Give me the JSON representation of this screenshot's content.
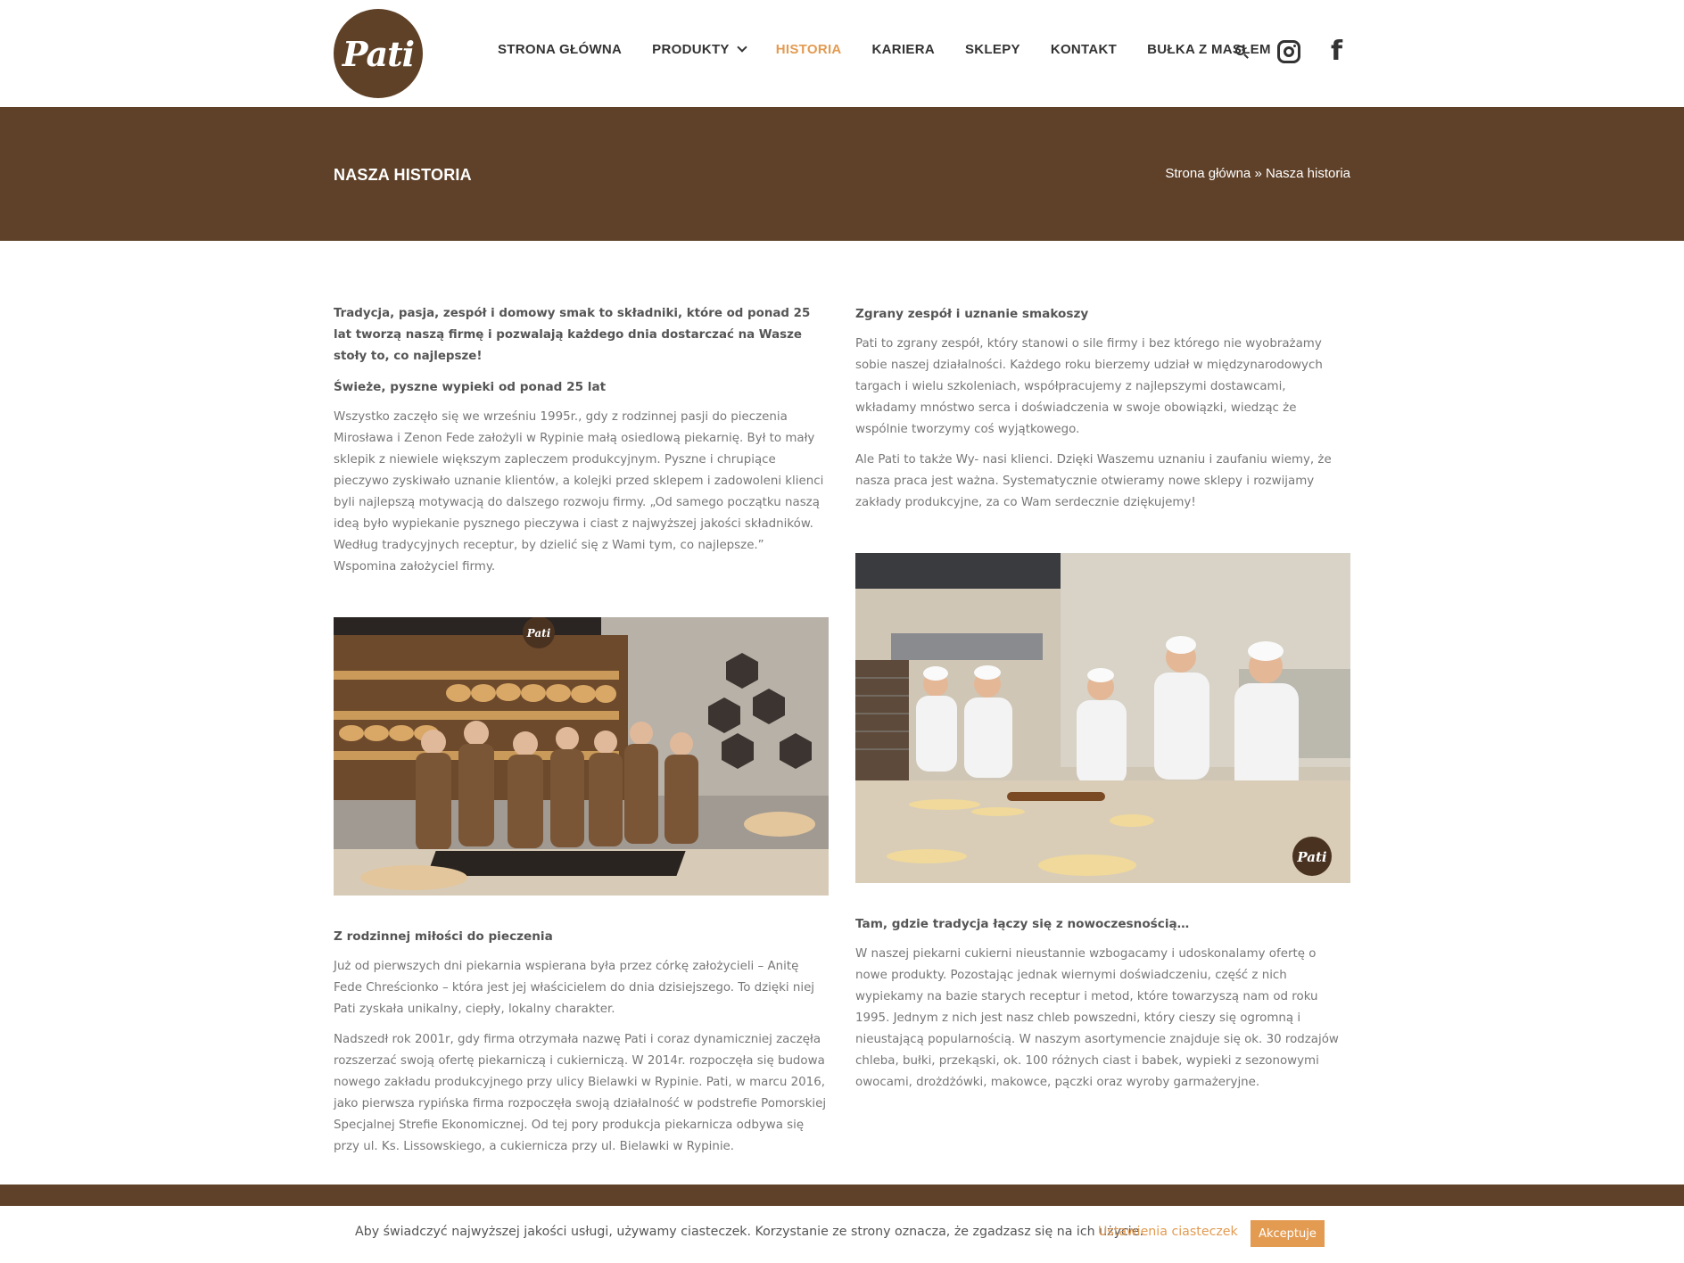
{
  "brand": {
    "logo_text": "Pati",
    "color": "#5f4127",
    "accent": "#e39b52"
  },
  "nav": {
    "items": [
      {
        "label": "STRONA GŁÓWNA"
      },
      {
        "label": "PRODUKTY"
      },
      {
        "label": "HISTORIA"
      },
      {
        "label": "KARIERA"
      },
      {
        "label": "SKLEPY"
      },
      {
        "label": "KONTAKT"
      },
      {
        "label": "BUŁKA Z MASŁEM"
      }
    ],
    "active": "HISTORIA",
    "icons": [
      "search-icon",
      "instagram-icon",
      "facebook-icon"
    ]
  },
  "header": {
    "title": "NASZA HISTORIA",
    "breadcrumb_home": "Strona główna",
    "breadcrumb_sep": "»",
    "breadcrumb_current": "Nasza historia"
  },
  "left": {
    "intro": "Tradycja, pasja, zespół i domowy smak to składniki, które od ponad 25 lat tworzą naszą firmę i pozwalają każdego dnia dostarczać na Wasze stoły to, co najlepsze!",
    "h1": "Świeże, pyszne wypieki od ponad 25 lat",
    "p1": "Wszystko zaczęło się we wrześniu 1995r., gdy z rodzinnej pasji do pieczenia Mirosława i Zenon Fede założyli w Rypinie małą osiedlową piekarnię. Był to mały sklepik z niewiele większym zapleczem produkcyjnym. Pyszne i chrupiące pieczywo zyskiwało uznanie klientów, a kolejki przed sklepem i zadowoleni klienci byli najlepszą motywacją do dalszego rozwoju firmy. „Od samego początku naszą ideą było wypiekanie pysznego pieczywa i ciast z najwyższej jakości składników. Według tradycyjnych receptur, by dzielić się z Wami tym, co najlepsze.” Wspomina założyciel firmy.",
    "h2": "Z rodzinnej miłości do pieczenia",
    "p2": "Już od pierwszych dni piekarnia wspierana była przez córkę założycieli – Anitę Fede Chreścionko – która jest jej właścicielem do dnia dzisiejszego. To dzięki niej Pati zyskała unikalny, ciepły, lokalny charakter.",
    "p3": "Nadszedł rok 2001r, gdy firma otrzymała nazwę Pati i coraz dynamiczniej zaczęła rozszerzać swoją ofertę piekarniczą i cukierniczą. W 2014r. rozpoczęła się budowa nowego zakładu produkcyjnego przy ulicy Bielawki w Rypinie. Pati, w marcu 2016, jako pierwsza rypińska firma rozpoczęła swoją działalność w podstrefie Pomorskiej Specjalnej Strefie Ekonomicznej. Od tej pory produkcja piekarnicza odbywa się przy ul. Ks. Lissowskiego, a cukiernicza przy ul. Bielawki w Rypinie."
  },
  "right": {
    "h1": "Zgrany zespół i uznanie smakoszy",
    "p1": "Pati to zgrany zespół, który stanowi o sile firmy i bez którego nie wyobrażamy sobie naszej działalności. Każdego roku bierzemy udział w międzynarodowych targach i wielu szkoleniach, współpracujemy z najlepszymi dostawcami, wkładamy mnóstwo serca i doświadczenia w swoje obowiązki, wiedząc że wspólnie tworzymy coś wyjątkowego.",
    "p2": "Ale Pati to także Wy- nasi klienci. Dzięki Waszemu uznaniu i zaufaniu wiemy, że nasza praca jest ważna. Systematycznie otwieramy nowe sklepy i rozwijamy zakłady produkcyjne, za co Wam serdecznie dziękujemy!",
    "h2": "Tam, gdzie tradycja łączy się z nowoczesnością…",
    "p3": "W naszej piekarni cukierni nieustannie wzbogacamy i udoskonalamy ofertę o nowe produkty. Pozostając jednak wiernymi doświadczeniu, część z nich wypiekamy na bazie starych receptur i metod, które towarzyszą nam od roku 1995. Jednym z nich jest nasz chleb powszedni, który cieszy się ogromną i nieustającą popularnością. W naszym asortymencie znajduje się ok. 30 rodzajów chleba, bułki, przekąski, ok. 100 różnych ciast i babek, wypieki z sezonowymi owocami, drożdżówki, makowce, pączki oraz wyroby garmażeryjne."
  },
  "photos": {
    "shop_logo": "Pati",
    "bakery_logo": "Pati"
  },
  "cookie": {
    "text": "Aby świadczyć najwyższej jakości usługi, używamy ciasteczek. Korzystanie ze strony oznacza, że zgadzasz się na ich użycie.",
    "settings_label": "Ustawienia ciasteczek",
    "accept_label": "Akceptuje"
  }
}
